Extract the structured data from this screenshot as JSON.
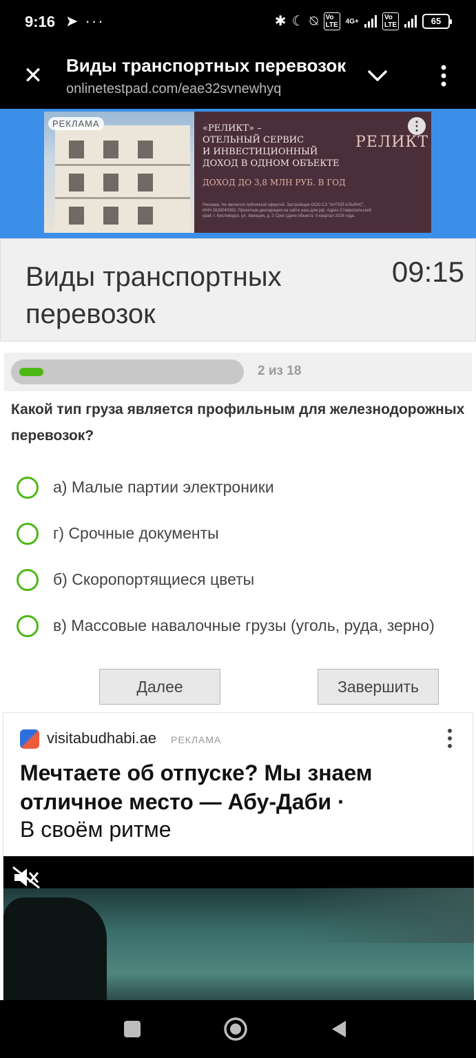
{
  "status_bar": {
    "time": "9:16",
    "left_icons": "➤ ···",
    "lte_1": "Vo\nLTE",
    "network_type": "4G+",
    "lte_2": "Vo\nLTE",
    "battery": "65"
  },
  "browser": {
    "title": "Виды транспортных перевозок",
    "url": "onlinetestpad.com/eae32svnewhyq"
  },
  "top_ad": {
    "tag": "РЕКЛАМА",
    "headline": "«Реликт» –\nотельный сервис\nи инвестиционный\nдоход в одном объекте",
    "income": "Доход до 3,8 млн руб. в год",
    "fine_print": "Реклама. Не является публичной офертой. Застройщик ООО СЗ \"АНТЕЙ-АЛЬЯНС\", ИНН 2628040363. Проектная декларация на сайте наш.дом.рф. Адрес:Ставропольский край, г. Кисловодск, ул. Авиации, д. 2 Срок сдачи объекта: II квартал 2028 года.",
    "logo": "РЕЛИКТ",
    "menu": "⋮"
  },
  "test": {
    "title": "Виды транспортных перевозок",
    "timer": "09:15",
    "progress_text": "2 из 18",
    "progress_fraction": 0.111,
    "question": "Какой тип груза является профильным для железнодорожных перевозок?",
    "options": [
      {
        "label": "а) Малые партии электроники"
      },
      {
        "label": "г) Срочные документы"
      },
      {
        "label": "б) Скоропортящиеся цветы"
      },
      {
        "label": "в) Массовые навалочные грузы (уголь, руда, зерно)"
      }
    ],
    "next_button": "Далее",
    "finish_button": "Завершить"
  },
  "bottom_ad": {
    "domain": "visitabudhabi.ae",
    "tag": "РЕКЛАМА",
    "headline": "Мечтаете об отпуске? Мы знаем отличное место — Абу-Даби ·",
    "subline": "В своём ритме"
  },
  "colors": {
    "accent": "#4cb814",
    "ad_blue": "#3c8fe8",
    "header_bg": "#f0f0f0"
  }
}
